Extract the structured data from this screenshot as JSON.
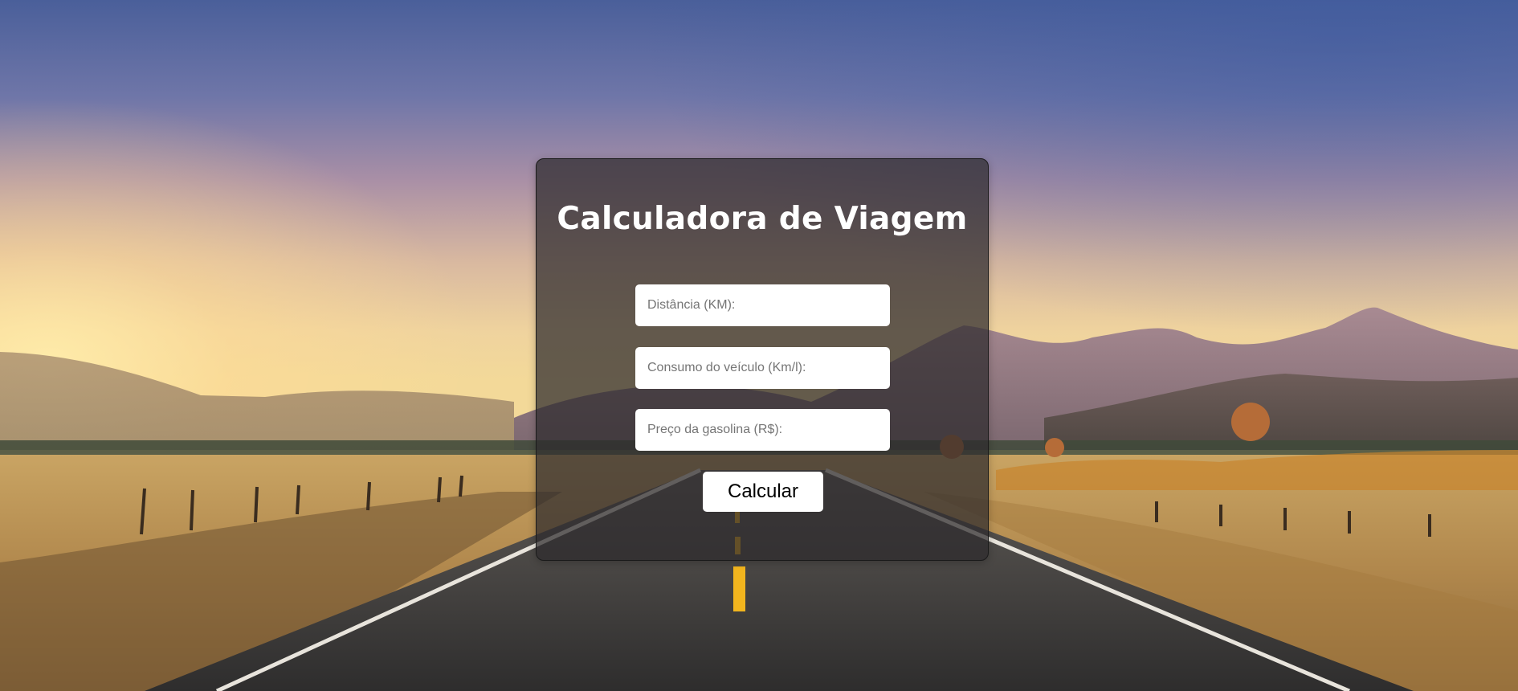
{
  "page": {
    "title": "Calculadora de Viagem"
  },
  "form": {
    "distance": {
      "value": "",
      "placeholder": "Distância (KM):"
    },
    "consumption": {
      "value": "",
      "placeholder": "Consumo do veículo (Km/l):"
    },
    "gas_price": {
      "value": "",
      "placeholder": "Preço da gasolina (R$):"
    },
    "submit_label": "Calcular"
  },
  "colors": {
    "card_background": "#2d2a2c",
    "title_text": "#ffffff",
    "input_background": "#ffffff",
    "road_line": "#f2b51e"
  }
}
